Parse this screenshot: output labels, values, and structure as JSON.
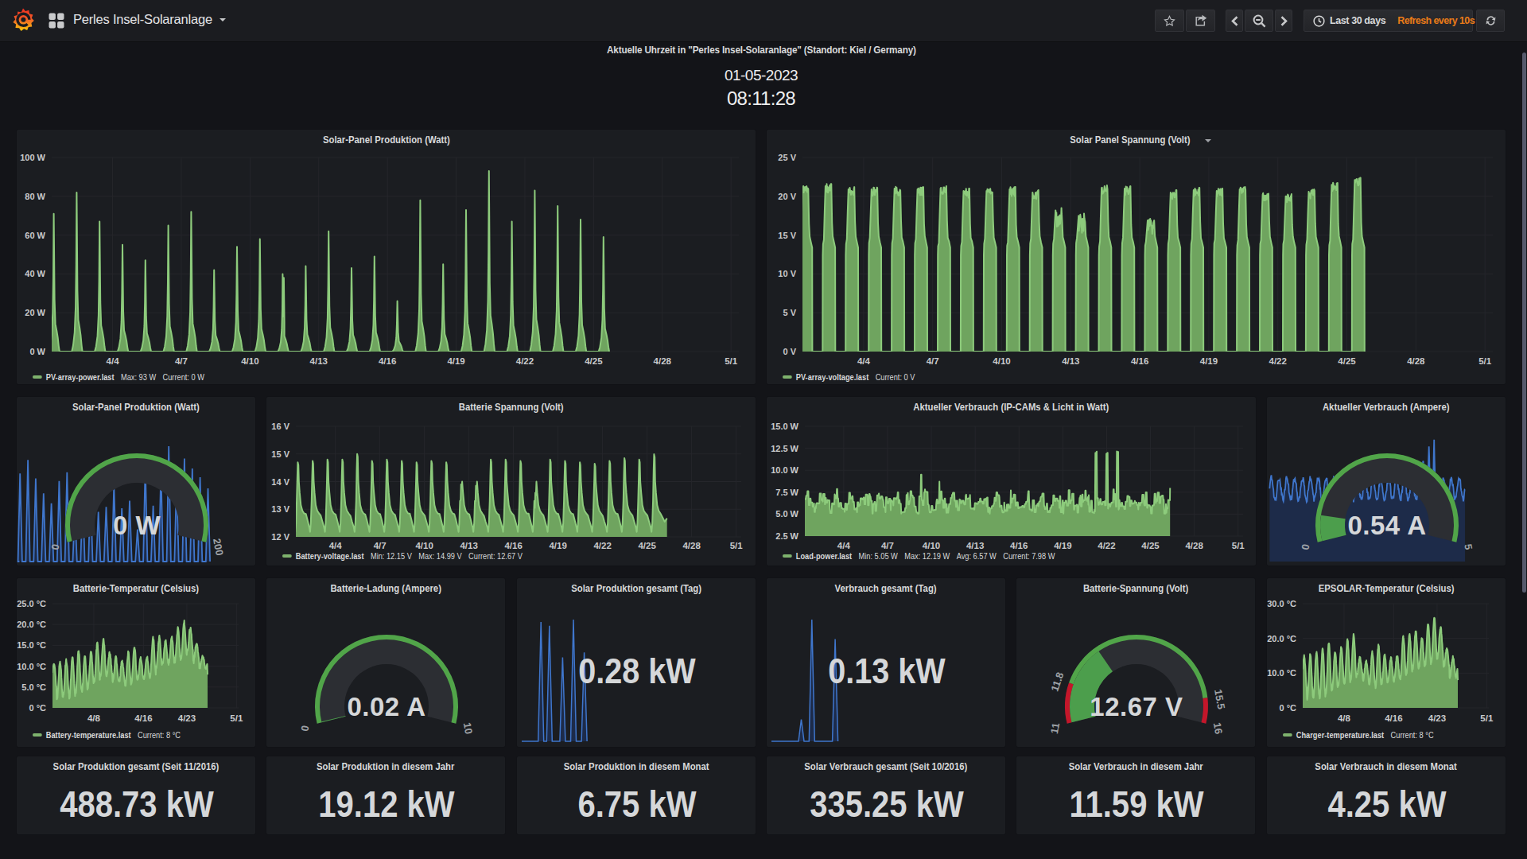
{
  "navbar": {
    "title": "Perles Insel-Solaranlage",
    "time_range": "Last 30 days",
    "refresh_interval": "Refresh every 10s"
  },
  "clock": {
    "title": "Aktuelle Uhrzeit in \"Perles Insel-Solaranlage\" (Standort: Kiel / Germany)",
    "date": "01-05-2023",
    "time": "08:11:28"
  },
  "colors": {
    "green_line": "#8dcb7c",
    "green_fill": "#6fa45f",
    "gauge_green": "#4c9e4c",
    "gauge_band_green": "#51a549",
    "gauge_red": "#c4162a",
    "blue_line": "#3f76cc",
    "blue_fill": "#1d2b49",
    "orange": "#eb7b18"
  },
  "chart_data": [
    {
      "id": "p1",
      "type": "area",
      "title": "Solar-Panel Produktion (Watt)",
      "ylabel": "Watt",
      "y_range": [
        0,
        100
      ],
      "y_ticks": [
        "0 W",
        "20 W",
        "40 W",
        "60 W",
        "80 W",
        "100 W"
      ],
      "x_ticks": [
        "4/4",
        "4/7",
        "4/10",
        "4/13",
        "4/16",
        "4/19",
        "4/22",
        "4/25",
        "4/28",
        "5/1"
      ],
      "x_tick_days": [
        3,
        6,
        9,
        12,
        15,
        18,
        21,
        24,
        27,
        30
      ],
      "series_kind": "solar_power",
      "categories_days": [
        "4/1",
        "4/2",
        "4/3",
        "4/4",
        "4/5",
        "4/6",
        "4/7",
        "4/8",
        "4/9",
        "4/10",
        "4/11",
        "4/12",
        "4/13",
        "4/14",
        "4/15",
        "4/16",
        "4/17",
        "4/18",
        "4/19",
        "4/20",
        "4/21",
        "4/22",
        "4/23",
        "4/24",
        "4/25"
      ],
      "day_peaks": [
        71,
        82,
        67,
        55,
        47,
        65,
        72,
        42,
        54,
        58,
        40,
        44,
        62,
        43,
        49,
        26,
        78,
        45,
        73,
        93,
        67,
        83,
        75,
        68,
        59
      ],
      "double_day": 10,
      "legend": {
        "name": "PV-array-power.last",
        "stats": [
          "Max: 93 W",
          "Current: 0 W"
        ]
      }
    },
    {
      "id": "p2",
      "type": "area",
      "title": "Solar Panel Spannung (Volt)",
      "caret": true,
      "ylabel": "Volt",
      "y_range": [
        0,
        25
      ],
      "y_ticks": [
        "0 V",
        "5 V",
        "10 V",
        "15 V",
        "20 V",
        "25 V"
      ],
      "x_ticks": [
        "4/4",
        "4/7",
        "4/10",
        "4/13",
        "4/16",
        "4/19",
        "4/22",
        "4/25",
        "4/28",
        "5/1"
      ],
      "x_tick_days": [
        3,
        6,
        9,
        12,
        15,
        18,
        21,
        24,
        27,
        30
      ],
      "series_kind": "pv_voltage",
      "day_peaks": [
        21.4,
        21.6,
        21.2,
        21.2,
        21.3,
        21.2,
        21.3,
        21.0,
        21.0,
        21.2,
        20.8,
        18.5,
        17.8,
        21.4,
        21.3,
        17.2,
        20.8,
        21.1,
        21.0,
        21.2,
        20.5,
        20.3,
        20.9,
        21.8,
        22.4
      ],
      "legend": {
        "name": "PV-array-voltage.last",
        "stats": [
          "Current: 0 V"
        ]
      }
    },
    {
      "id": "g1",
      "type": "gauge",
      "title": "Solar-Panel Produktion (Watt)",
      "value": "0 W",
      "min_label": "0",
      "max_label": "200",
      "fraction": 0,
      "sparkline": "solar_power"
    },
    {
      "id": "c2",
      "type": "area",
      "title": "Batterie Spannung (Volt)",
      "ylabel": "Volt",
      "y_range": [
        12,
        16
      ],
      "y_ticks": [
        "12 V",
        "13 V",
        "14 V",
        "15 V",
        "16 V"
      ],
      "x_ticks": [
        "4/4",
        "4/7",
        "4/10",
        "4/13",
        "4/16",
        "4/19",
        "4/22",
        "4/25",
        "4/28",
        "5/1"
      ],
      "x_tick_days": [
        3,
        6,
        9,
        12,
        15,
        18,
        21,
        24,
        27,
        30
      ],
      "series_kind": "battery_voltage",
      "day_peaks": [
        14.7,
        14.75,
        14.8,
        14.8,
        15.0,
        14.75,
        14.8,
        14.75,
        14.7,
        14.75,
        14.7,
        13.9,
        13.85,
        14.8,
        14.8,
        14.75,
        13.6,
        14.8,
        14.75,
        14.7,
        14.65,
        14.75,
        14.85,
        14.8,
        14.99
      ],
      "legend": {
        "name": "Battery-voltage.last",
        "stats": [
          "Min: 12.15 V",
          "Max: 14.99 V",
          "Current: 12.67 V"
        ]
      }
    },
    {
      "id": "c3",
      "type": "area",
      "title": "Aktueller Verbrauch (IP-CAMs & Licht in Watt)",
      "ylabel": "Watt",
      "y_range": [
        2.5,
        15
      ],
      "y_ticks": [
        "2.5 W",
        "5.0 W",
        "7.5 W",
        "10.0 W",
        "12.5 W",
        "15.0 W"
      ],
      "x_ticks": [
        "4/4",
        "4/7",
        "4/10",
        "4/13",
        "4/16",
        "4/19",
        "4/22",
        "4/25",
        "4/28",
        "5/1"
      ],
      "x_tick_days": [
        3,
        6,
        9,
        12,
        15,
        18,
        21,
        24,
        27,
        30
      ],
      "series_kind": "load_power",
      "spikes": [
        [
          20.28,
          12.19
        ],
        [
          21.02,
          12.05
        ],
        [
          21.75,
          12.19
        ]
      ],
      "legend": {
        "name": "Load-power.last",
        "stats": [
          "Min: 5.05 W",
          "Max: 12.19 W",
          "Avg: 6.57 W",
          "Current: 7.98 W"
        ]
      }
    },
    {
      "id": "g4",
      "type": "gauge",
      "title": "Aktueller Verbrauch (Ampere)",
      "value": "0.54 A",
      "min_label": "0",
      "max_label": "5",
      "fraction": 0.108,
      "sparkline": "load_current"
    },
    {
      "id": "r3c1",
      "type": "area",
      "title": "Batterie-Temperatur (Celsius)",
      "ylabel": "Celsius",
      "y_range": [
        0,
        25
      ],
      "y_ticks": [
        "0 °C",
        "5.0 °C",
        "10.0 °C",
        "15.0 °C",
        "20.0 °C",
        "25.0 °C"
      ],
      "x_ticks": [
        "4/8",
        "4/16",
        "4/23",
        "5/1"
      ],
      "x_tick_days": [
        7,
        15,
        22,
        30
      ],
      "series_kind": "temperature",
      "day_peaks": [
        11,
        11.3,
        11.5,
        12,
        13.8,
        12.2,
        13.5,
        15.5,
        16.5,
        13.2,
        12,
        11.2,
        13.3,
        14.8,
        11.8,
        12.2,
        16.8,
        17,
        16,
        17,
        19,
        20.6,
        19.2,
        15.5,
        12.5
      ],
      "day_mins": [
        4.5,
        2,
        3,
        2.5,
        3.5,
        4,
        5,
        6,
        7.5,
        7.8,
        6.5,
        6,
        5.2,
        6,
        6.8,
        7,
        7.5,
        9.5,
        10.5,
        10.5,
        11,
        12,
        13.5,
        11,
        9.5
      ],
      "end_value": 8,
      "legend": {
        "name": "Battery-temperature.last",
        "stats": [
          "Current: 8 °C"
        ]
      }
    },
    {
      "id": "r3g1",
      "type": "gauge",
      "title": "Batterie-Ladung (Ampere)",
      "value": "0.02 A",
      "min_label": "0",
      "max_label": "10",
      "fraction": 0.002
    },
    {
      "id": "r3s1",
      "type": "stat",
      "title": "Solar Produktion gesamt (Tag)",
      "value": "0.28 kW",
      "spikes_f": [
        0.1,
        0.135,
        0.19,
        0.235,
        0.28
      ],
      "spikes_h": [
        0.98,
        0.95,
        0.69,
        1.0,
        0.73
      ]
    },
    {
      "id": "r3s2",
      "type": "stat",
      "title": "Verbrauch gesamt (Tag)",
      "value": "0.13 kW",
      "spikes_f": [
        0.144,
        0.188,
        0.285
      ],
      "spikes_h": [
        0.18,
        1.0,
        0.84
      ]
    },
    {
      "id": "r3g2",
      "type": "gauge",
      "title": "Batterie-Spannung (Volt)",
      "value": "12.67 V",
      "min_label": "11",
      "max_label": "16",
      "fraction": 0.334,
      "bands": [
        {
          "from": 0,
          "to": 0.16,
          "color": "red"
        },
        {
          "from": 0.16,
          "to": 0.9,
          "color": "green"
        },
        {
          "from": 0.9,
          "to": 1,
          "color": "red"
        }
      ],
      "band_labels": [
        {
          "label": "11.8",
          "f": 0.16
        },
        {
          "label": "15.5",
          "f": 0.9
        }
      ]
    },
    {
      "id": "r3c6",
      "type": "area",
      "title": "EPSOLAR-Temperatur (Celsius)",
      "ylabel": "Celsius",
      "y_range": [
        0,
        30
      ],
      "y_ticks": [
        "0 °C",
        "10.0 °C",
        "20.0 °C",
        "30.0 °C"
      ],
      "x_ticks": [
        "4/8",
        "4/16",
        "4/23",
        "5/1"
      ],
      "x_tick_days": [
        7,
        15,
        22,
        30
      ],
      "series_kind": "temperature",
      "day_peaks": [
        15,
        15.5,
        16,
        17,
        18.8,
        16.3,
        17.5,
        19.5,
        21,
        14.5,
        13.5,
        16,
        18,
        15.2,
        14.3,
        15,
        20.5,
        21,
        22,
        20.3,
        24,
        26,
        23.2,
        17,
        14.5
      ],
      "day_mins": [
        5,
        2.5,
        3,
        2.8,
        4,
        5,
        6.5,
        7,
        8,
        9.5,
        8,
        6.5,
        6,
        7,
        7.5,
        7.8,
        8.5,
        10,
        11,
        11.5,
        12,
        13,
        14.5,
        11.5,
        9
      ],
      "end_value": 8,
      "legend": {
        "name": "Charger-temperature.last",
        "stats": [
          "Current: 8 °C"
        ]
      }
    },
    {
      "id": "s1",
      "type": "bigstat",
      "title": "Solar Produktion gesamt (Seit 11/2016)",
      "value": "488.73 kW"
    },
    {
      "id": "s2",
      "type": "bigstat",
      "title": "Solar Produktion in diesem Jahr",
      "value": "19.12 kW"
    },
    {
      "id": "s3",
      "type": "bigstat",
      "title": "Solar Produktion in diesem Monat",
      "value": "6.75 kW"
    },
    {
      "id": "s4",
      "type": "bigstat",
      "title": "Solar Verbrauch gesamt (Seit 10/2016)",
      "value": "335.25 kW"
    },
    {
      "id": "s5",
      "type": "bigstat",
      "title": "Solar Verbrauch in diesem Jahr",
      "value": "11.59 kW"
    },
    {
      "id": "s6",
      "type": "bigstat",
      "title": "Solar Verbrauch in diesem Monat",
      "value": "4.25 kW"
    }
  ]
}
